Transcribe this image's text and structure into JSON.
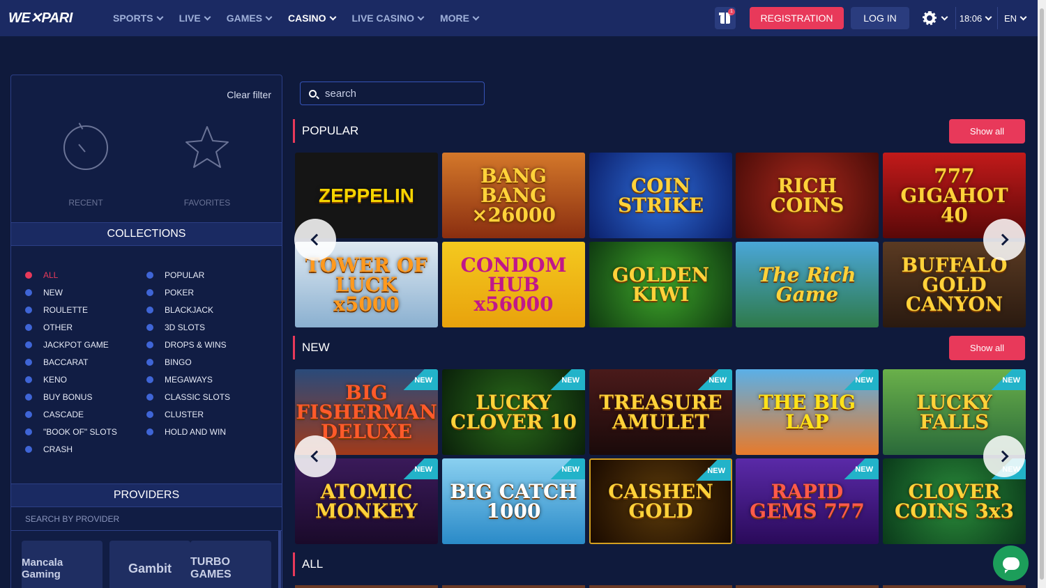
{
  "header": {
    "logo": "WE✕PARI",
    "nav": [
      {
        "label": "SPORTS"
      },
      {
        "label": "LIVE"
      },
      {
        "label": "GAMES"
      },
      {
        "label": "CASINO"
      },
      {
        "label": "LIVE CASINO"
      },
      {
        "label": "MORE"
      }
    ],
    "active_nav": "CASINO",
    "gift_badge": "1",
    "registration_label": "REGISTRATION",
    "login_label": "LOG IN",
    "time": "18:06",
    "language": "EN"
  },
  "sidebar": {
    "clear_filter": "Clear filter",
    "recent_label": "RECENT",
    "favorites_label": "FAVORITES",
    "collections_title": "COLLECTIONS",
    "collections_left": [
      "ALL",
      "NEW",
      "ROULETTE",
      "OTHER",
      "JACKPOT GAME",
      "BACCARAT",
      "KENO",
      "BUY BONUS",
      "CASCADE",
      "\"BOOK OF\" SLOTS",
      "CRASH"
    ],
    "collections_right": [
      "POPULAR",
      "POKER",
      "BLACKJACK",
      "3D SLOTS",
      "DROPS & WINS",
      "BINGO",
      "MEGAWAYS",
      "CLASSIC SLOTS",
      "CLUSTER",
      "HOLD AND WIN"
    ],
    "active_collection": "ALL",
    "providers_title": "PROVIDERS",
    "provider_search_placeholder": "SEARCH BY PROVIDER",
    "providers": [
      "Mancala Gaming",
      "Gambit",
      "TURBO GAMES"
    ]
  },
  "main": {
    "search_placeholder": "search",
    "popular": {
      "title": "POPULAR",
      "show_all": "Show all",
      "games": [
        {
          "name": "ZEPPELIN"
        },
        {
          "name": "BANG BANG ×26000"
        },
        {
          "name": "COIN STRIKE"
        },
        {
          "name": "RICH COINS"
        },
        {
          "name": "777 GIGAHOT 40"
        },
        {
          "name": "TOWER OF LUCK x5000"
        },
        {
          "name": "CONDOM HUB x56000"
        },
        {
          "name": "GOLDEN KIWI"
        },
        {
          "name": "The Rich Game"
        },
        {
          "name": "BUFFALO GOLD CANYON"
        }
      ]
    },
    "new": {
      "title": "NEW",
      "show_all": "Show all",
      "badge": "NEW",
      "games": [
        {
          "name": "BIG FISHERMAN DELUXE"
        },
        {
          "name": "LUCKY CLOVER 10"
        },
        {
          "name": "TREASURE AMULET"
        },
        {
          "name": "THE BIG LAP"
        },
        {
          "name": "LUCKY FALLS"
        },
        {
          "name": "ATOMIC MONKEY"
        },
        {
          "name": "BIG CATCH 1000"
        },
        {
          "name": "CAISHEN GOLD"
        },
        {
          "name": "RAPID GEMS 777"
        },
        {
          "name": "CLOVER COINS 3x3"
        }
      ]
    },
    "all": {
      "title": "ALL"
    }
  },
  "colors": {
    "background": "#0f1a3c",
    "header": "#1b2a63",
    "accent": "#e8395a",
    "collection_dot": "#3f65d6",
    "new_badge": "#22b3c9",
    "chat": "#1c9e5a"
  }
}
